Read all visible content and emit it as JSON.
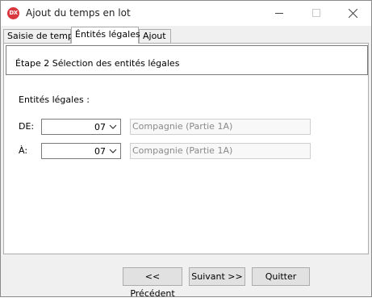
{
  "window": {
    "title": "Ajout du temps en lot",
    "app_icon_text": "DX"
  },
  "tabs": [
    {
      "label": "Saisie de temps",
      "active": false
    },
    {
      "label": "Éntités légales",
      "active": true
    },
    {
      "label": "Ajout",
      "active": false
    }
  ],
  "step": {
    "text": "Étape 2  Sélection des entités légales"
  },
  "section": {
    "label": "Entités légales :"
  },
  "rows": [
    {
      "label": "DE:",
      "value": "07",
      "description": "Compagnie (Partie 1A)"
    },
    {
      "label": "À:",
      "value": "07",
      "description": "Compagnie (Partie 1A)"
    }
  ],
  "buttons": {
    "previous": "<< Précédent",
    "next": "Suivant >>",
    "quit": "Quitter"
  },
  "colors": {
    "icon_red": "#d9363e",
    "window_bg": "#f0f0f0",
    "panel_bg": "#ffffff"
  }
}
